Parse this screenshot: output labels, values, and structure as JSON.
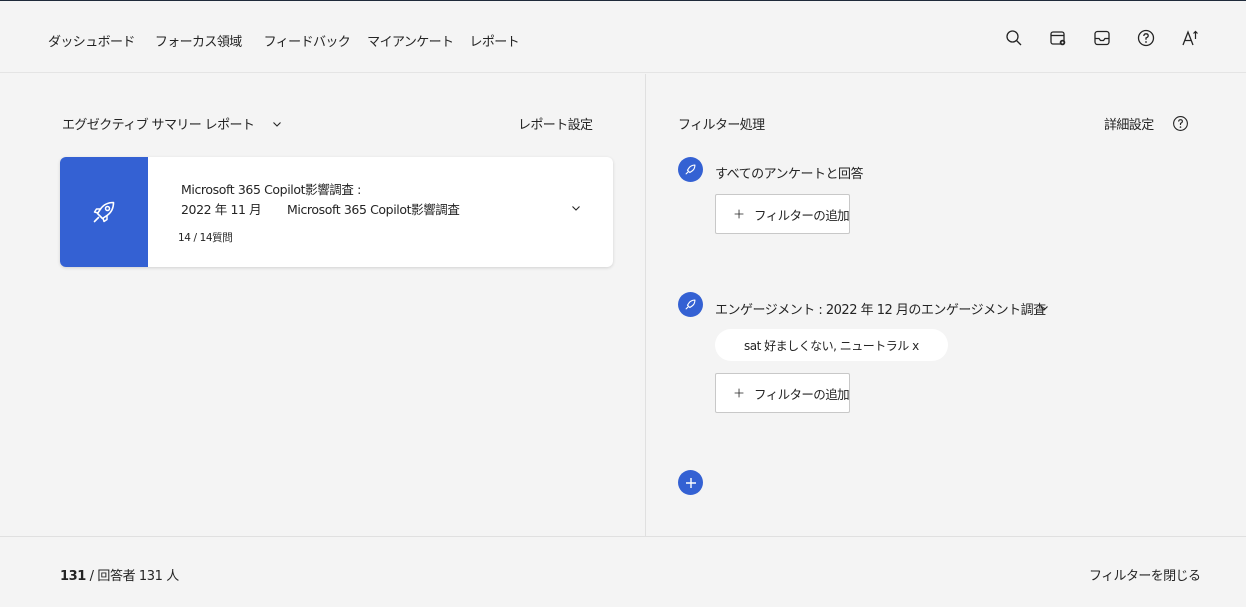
{
  "nav": {
    "items": [
      {
        "label": "ダッシュボード"
      },
      {
        "label": "フォーカス領域"
      },
      {
        "label": "フィードバック"
      },
      {
        "label": "マイアンケート"
      },
      {
        "label": "レポート"
      }
    ]
  },
  "top_icons": [
    "search-icon",
    "calendar-settings-icon",
    "inbox-icon",
    "help-icon",
    "text-size-icon"
  ],
  "left": {
    "report_selector": "エグゼクティブ サマリー レポート",
    "report_settings": "レポート設定",
    "card": {
      "title_line1": "Microsoft 365 Copilot影響調査 :",
      "title_line2_date": "2022 年 11 月",
      "title_line2_name": "Microsoft 365 Copilot影響調査",
      "question_count": "14 / 14質問",
      "accent_color": "#3461d3",
      "icon": "rocket-icon"
    }
  },
  "right": {
    "title": "フィルター処理",
    "advanced_settings": "詳細設定",
    "group1": {
      "label": "すべてのアンケートと回答",
      "add_filter": "フィルターの追加"
    },
    "group2": {
      "label": "エンゲージメント : 2022 年 12 月のエンゲージメント調査",
      "chip": "sat 好ましくない, ニュートラル x",
      "add_filter": "フィルターの追加"
    }
  },
  "footer": {
    "respondents_bold": "131",
    "respondents_rest": " / 回答者 131 人",
    "close_filters": "フィルターを閉じる"
  }
}
